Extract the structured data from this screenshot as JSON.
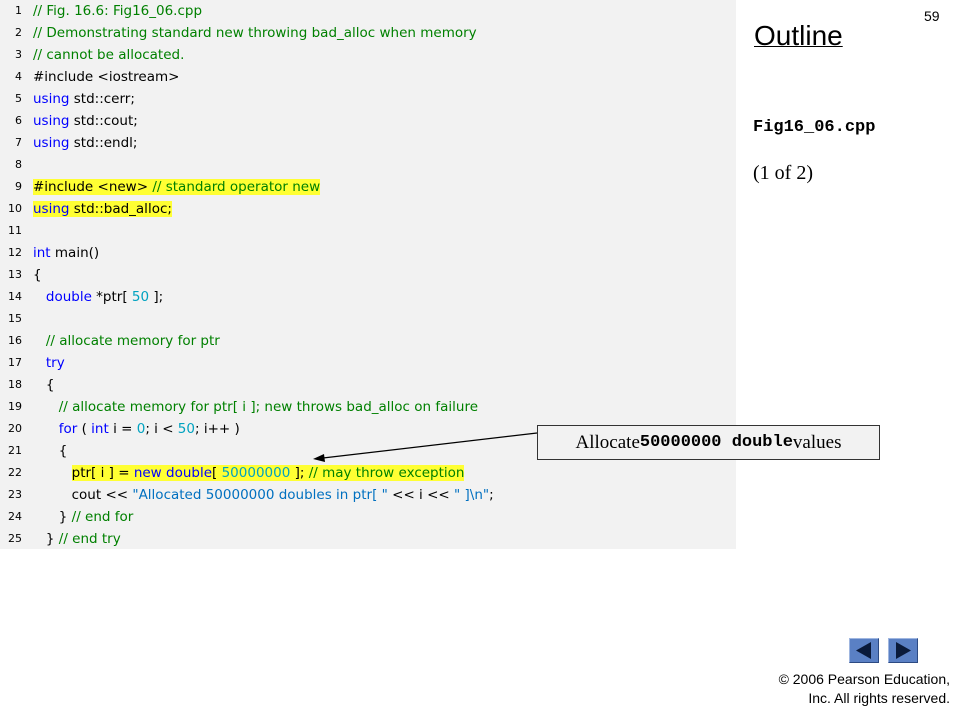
{
  "slide_number": "59",
  "outline_title": "Outline",
  "filename": "Fig16_06.cpp",
  "page_indicator": "(1 of 2)",
  "callout": {
    "prefix": "Allocate ",
    "code": "50000000 double",
    "suffix": " values"
  },
  "copyright": {
    "line1": "© 2006 Pearson Education,",
    "line2": "Inc.  All rights reserved."
  },
  "colors": {
    "comment": "#008000",
    "keyword": "#0000ff",
    "number": "#00a2c0",
    "string": "#0070c0",
    "highlight": "#ffff33",
    "code_background": "#f2f2f2",
    "nav_button": "#5a80c4"
  },
  "nav": {
    "prev_icon": "triangle-left-icon",
    "next_icon": "triangle-right-icon"
  },
  "code_lines": [
    {
      "n": "1",
      "highlight": false,
      "tokens": [
        {
          "t": "// Fig. 16.6: Fig16_06.cpp",
          "c": "comment"
        }
      ]
    },
    {
      "n": "2",
      "highlight": false,
      "tokens": [
        {
          "t": "// Demonstrating standard new throwing bad_alloc when memory",
          "c": "comment"
        }
      ]
    },
    {
      "n": "3",
      "highlight": false,
      "tokens": [
        {
          "t": "// cannot be allocated.",
          "c": "comment"
        }
      ]
    },
    {
      "n": "4",
      "highlight": false,
      "tokens": [
        {
          "t": "#include <iostream>",
          "c": "plain"
        }
      ]
    },
    {
      "n": "5",
      "highlight": false,
      "tokens": [
        {
          "t": "using",
          "c": "kw"
        },
        {
          "t": " std::cerr;",
          "c": "plain"
        }
      ]
    },
    {
      "n": "6",
      "highlight": false,
      "tokens": [
        {
          "t": "using",
          "c": "kw"
        },
        {
          "t": " std::cout;",
          "c": "plain"
        }
      ]
    },
    {
      "n": "7",
      "highlight": false,
      "tokens": [
        {
          "t": "using",
          "c": "kw"
        },
        {
          "t": " std::endl;",
          "c": "plain"
        }
      ]
    },
    {
      "n": "8",
      "highlight": false,
      "tokens": []
    },
    {
      "n": "9",
      "highlight": true,
      "tokens": [
        {
          "t": "#include <new> ",
          "c": "plain"
        },
        {
          "t": "// standard operator new",
          "c": "comment"
        }
      ]
    },
    {
      "n": "10",
      "highlight": true,
      "tokens": [
        {
          "t": "using",
          "c": "kw"
        },
        {
          "t": " std::bad_alloc;",
          "c": "plain"
        }
      ]
    },
    {
      "n": "11",
      "highlight": false,
      "tokens": []
    },
    {
      "n": "12",
      "highlight": false,
      "tokens": [
        {
          "t": "int",
          "c": "kw"
        },
        {
          "t": " main()",
          "c": "plain"
        }
      ]
    },
    {
      "n": "13",
      "highlight": false,
      "tokens": [
        {
          "t": "{",
          "c": "plain"
        }
      ]
    },
    {
      "n": "14",
      "highlight": false,
      "tokens": [
        {
          "t": "   ",
          "c": "plain"
        },
        {
          "t": "double",
          "c": "kw"
        },
        {
          "t": " *ptr[ ",
          "c": "plain"
        },
        {
          "t": "50",
          "c": "num"
        },
        {
          "t": " ];",
          "c": "plain"
        }
      ]
    },
    {
      "n": "15",
      "highlight": false,
      "tokens": []
    },
    {
      "n": "16",
      "highlight": false,
      "tokens": [
        {
          "t": "   ",
          "c": "plain"
        },
        {
          "t": "// allocate memory for ptr",
          "c": "comment"
        }
      ]
    },
    {
      "n": "17",
      "highlight": false,
      "tokens": [
        {
          "t": "   ",
          "c": "plain"
        },
        {
          "t": "try",
          "c": "kw"
        }
      ]
    },
    {
      "n": "18",
      "highlight": false,
      "tokens": [
        {
          "t": "   {",
          "c": "plain"
        }
      ]
    },
    {
      "n": "19",
      "highlight": false,
      "tokens": [
        {
          "t": "      ",
          "c": "plain"
        },
        {
          "t": "// allocate memory for ptr[ i ]; new throws bad_alloc on failure",
          "c": "comment"
        }
      ]
    },
    {
      "n": "20",
      "highlight": false,
      "tokens": [
        {
          "t": "      ",
          "c": "plain"
        },
        {
          "t": "for",
          "c": "kw"
        },
        {
          "t": " ( ",
          "c": "plain"
        },
        {
          "t": "int",
          "c": "kw"
        },
        {
          "t": " i = ",
          "c": "plain"
        },
        {
          "t": "0",
          "c": "num"
        },
        {
          "t": "; i < ",
          "c": "plain"
        },
        {
          "t": "50",
          "c": "num"
        },
        {
          "t": "; i++ )",
          "c": "plain"
        }
      ]
    },
    {
      "n": "21",
      "highlight": false,
      "tokens": [
        {
          "t": "      {",
          "c": "plain"
        }
      ]
    },
    {
      "n": "22",
      "highlight": true,
      "lead": "         ",
      "tokens": [
        {
          "t": "ptr[ i ] = ",
          "c": "plain"
        },
        {
          "t": "new",
          "c": "kw"
        },
        {
          "t": " ",
          "c": "plain"
        },
        {
          "t": "double",
          "c": "kw"
        },
        {
          "t": "[ ",
          "c": "plain"
        },
        {
          "t": "50000000",
          "c": "num"
        },
        {
          "t": " ]; ",
          "c": "plain"
        },
        {
          "t": "// may throw exception",
          "c": "comment"
        }
      ]
    },
    {
      "n": "23",
      "highlight": false,
      "tokens": [
        {
          "t": "         cout << ",
          "c": "plain"
        },
        {
          "t": "\"Allocated 50000000 doubles in ptr[ \"",
          "c": "str"
        },
        {
          "t": " << i << ",
          "c": "plain"
        },
        {
          "t": "\" ]\\n\"",
          "c": "str"
        },
        {
          "t": ";",
          "c": "plain"
        }
      ]
    },
    {
      "n": "24",
      "highlight": false,
      "tokens": [
        {
          "t": "      } ",
          "c": "plain"
        },
        {
          "t": "// end for",
          "c": "comment"
        }
      ]
    },
    {
      "n": "25",
      "highlight": false,
      "tokens": [
        {
          "t": "   } ",
          "c": "plain"
        },
        {
          "t": "// end try",
          "c": "comment"
        }
      ]
    }
  ]
}
